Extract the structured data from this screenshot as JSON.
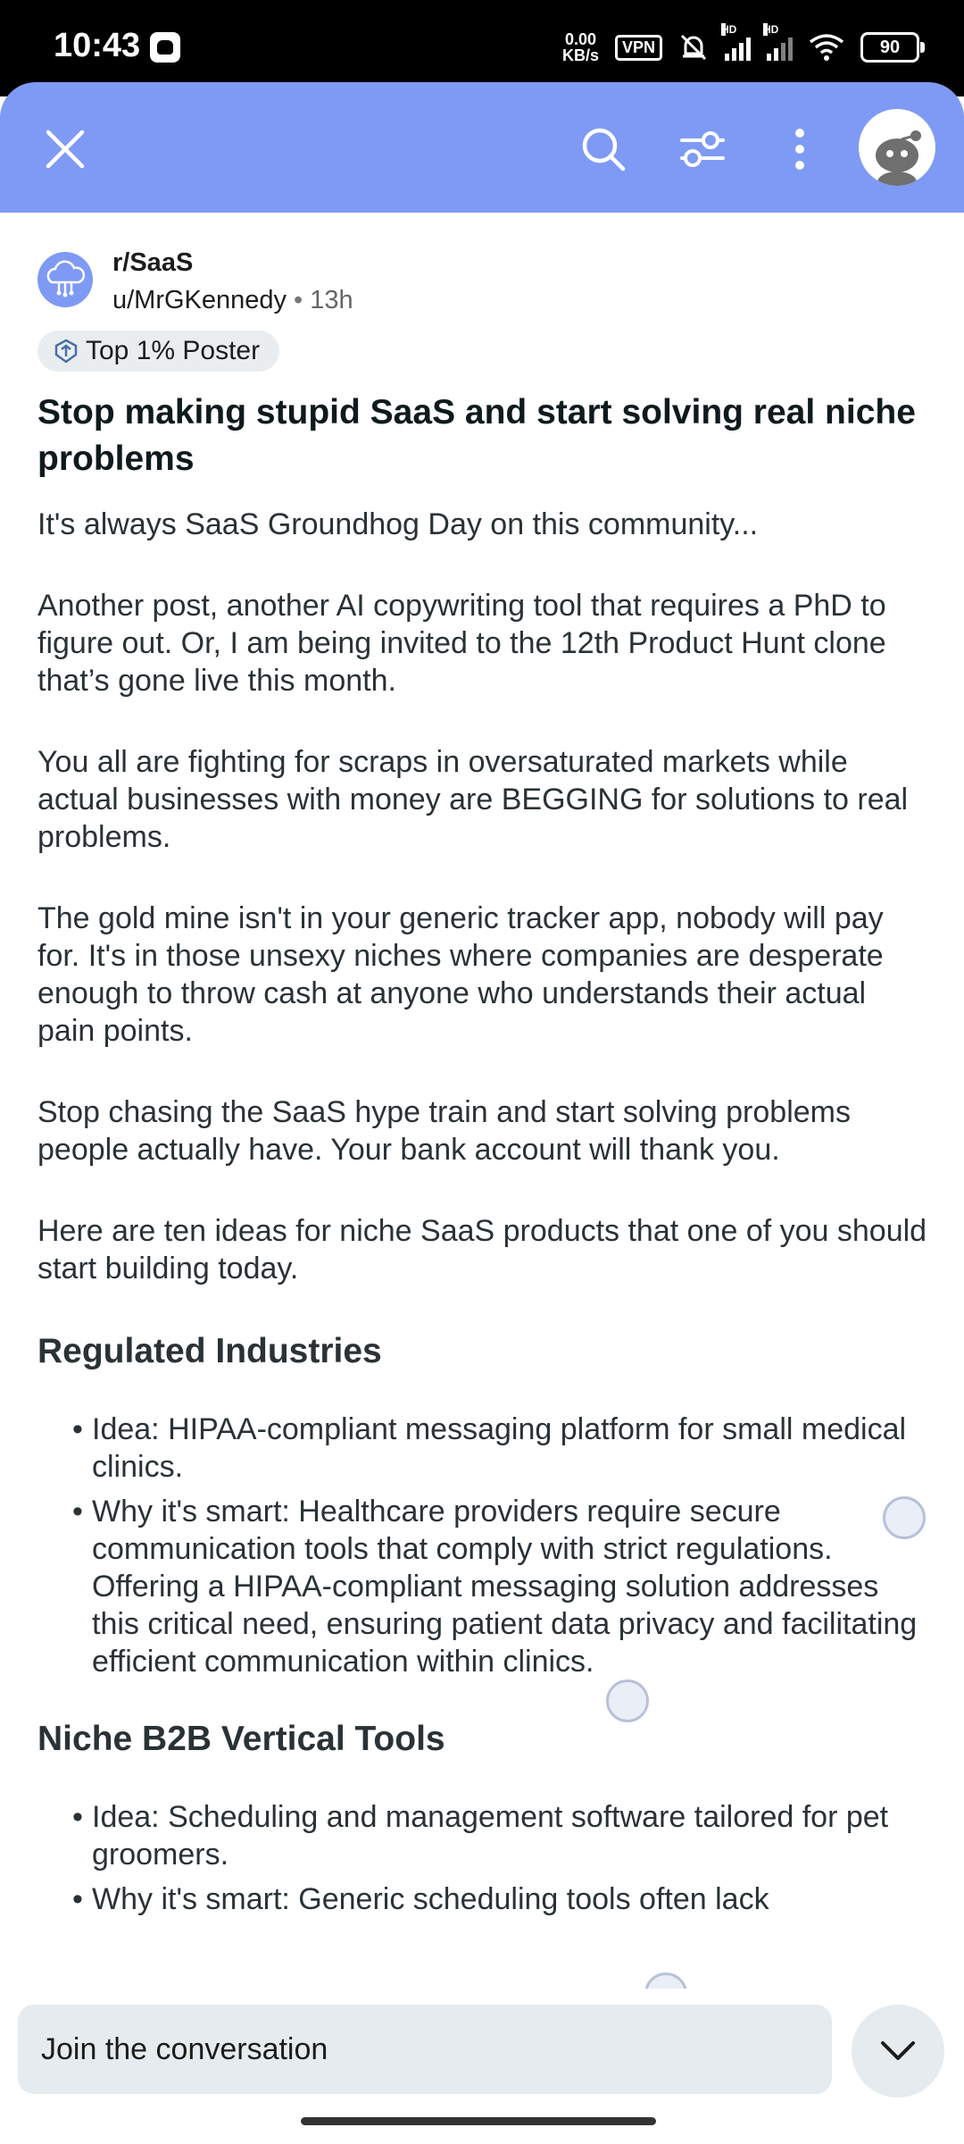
{
  "status_bar": {
    "time": "10:43",
    "net_speed_value": "0.00",
    "net_speed_unit": "KB/s",
    "vpn": "VPN",
    "hd1": "HD",
    "hd2": "HD",
    "battery": "90"
  },
  "header": {
    "close_icon": "close-icon",
    "search_icon": "search-icon",
    "filter_icon": "sort-filter-icon",
    "more_icon": "more-vertical-icon",
    "accent_color": "#7f9af4"
  },
  "post": {
    "subreddit": "r/SaaS",
    "author": "u/MrGKennedy",
    "separator": "•",
    "age": "13h",
    "flair": "Top 1% Poster",
    "title": "Stop making stupid SaaS and start solving real niche problems",
    "paragraphs": [
      "It's always SaaS Groundhog Day on this community...",
      "Another post, another AI copywriting tool that requires a PhD to figure out. Or, I am being invited to the 12th Product Hunt clone that’s gone live this month.",
      "You all are fighting for scraps in oversaturated markets while actual businesses with money are BEGGING for solutions to real problems.",
      "The gold mine isn't in your generic tracker app, nobody will pay for. It's in those unsexy niches where companies are desperate enough to throw cash at anyone who understands their actual pain points.",
      "Stop chasing the SaaS hype train and start solving problems people actually have. Your bank account will thank you.",
      "Here are ten ideas for niche SaaS products that one of you should start building today."
    ],
    "sections": [
      {
        "heading": "Regulated Industries",
        "items": [
          "Idea: HIPAA-compliant messaging platform for small medical clinics.",
          "Why it's smart: Healthcare providers require secure communication tools that comply with strict regulations. Offering a HIPAA-compliant messaging solution addresses this critical need, ensuring patient data privacy and facilitating efficient communication within clinics."
        ]
      },
      {
        "heading": "Niche B2B Vertical Tools",
        "items": [
          "Idea: Scheduling and management software tailored for pet groomers.",
          "Why it's smart: Generic scheduling tools often lack"
        ]
      }
    ]
  },
  "bottom": {
    "join_placeholder": "Join the conversation",
    "expand_icon": "chevron-down-icon"
  }
}
